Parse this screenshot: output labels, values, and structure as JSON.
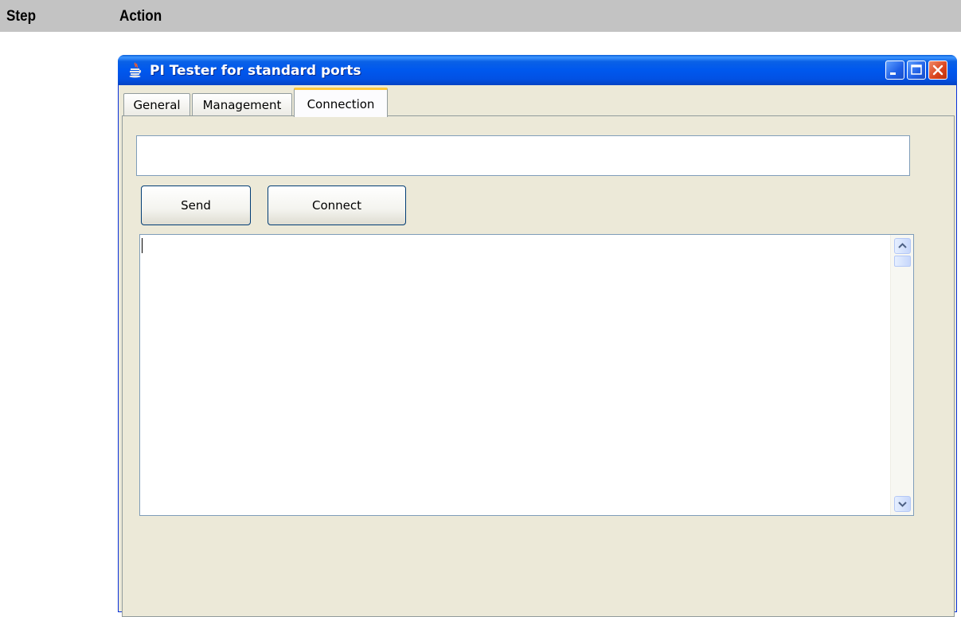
{
  "doc_table": {
    "headers": [
      "Step",
      "Action"
    ]
  },
  "window": {
    "title": "PI Tester for standard ports",
    "icon": "java-cup-icon",
    "controls": [
      "minimize-icon",
      "maximize-icon",
      "close-icon"
    ]
  },
  "tabs": [
    {
      "label": "General",
      "active": false
    },
    {
      "label": "Management",
      "active": false
    },
    {
      "label": "Connection",
      "active": true
    }
  ],
  "connection": {
    "input_value": "",
    "send_label": "Send",
    "connect_label": "Connect",
    "output_text": ""
  },
  "colors": {
    "titlebar": "#0058ee",
    "window_bg": "#ece9d8",
    "active_tab_accent": "#ffc83c",
    "close_button": "#d9421c",
    "header_bg": "#c3c3c3"
  }
}
